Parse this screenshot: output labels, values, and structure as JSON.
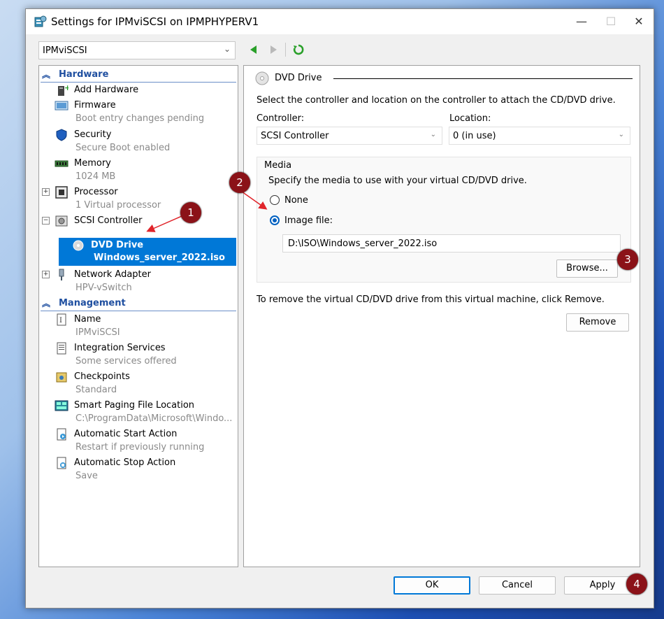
{
  "window": {
    "title": "Settings for IPMviSCSI on IPMPHYPERV1",
    "minimize_glyph": "—",
    "maximize_glyph": "☐",
    "close_glyph": "✕"
  },
  "vm_selector": {
    "value": "IPMviSCSI",
    "arrow": "⌄"
  },
  "tree": {
    "hardware_heading": "Hardware",
    "management_heading": "Management",
    "items": {
      "add_hardware": {
        "label": "Add Hardware",
        "icon": "add-hardware-icon"
      },
      "firmware": {
        "label": "Firmware",
        "sub": "Boot entry changes pending",
        "icon": "firmware-icon"
      },
      "security": {
        "label": "Security",
        "sub": "Secure Boot enabled",
        "icon": "shield-icon"
      },
      "memory": {
        "label": "Memory",
        "sub": "1024 MB",
        "icon": "memory-icon"
      },
      "processor": {
        "label": "Processor",
        "sub": "1 Virtual processor",
        "icon": "processor-icon",
        "expander": "+"
      },
      "scsi": {
        "label": "SCSI Controller",
        "icon": "scsi-controller-icon",
        "expander": "−"
      },
      "dvd": {
        "label": "DVD Drive",
        "sub": "Windows_server_2022.iso",
        "icon": "dvd-icon"
      },
      "network": {
        "label": "Network Adapter",
        "sub": "HPV-vSwitch",
        "icon": "network-adapter-icon",
        "expander": "+"
      },
      "name": {
        "label": "Name",
        "sub": "IPMviSCSI",
        "icon": "name-icon"
      },
      "integration": {
        "label": "Integration Services",
        "sub": "Some services offered",
        "icon": "integration-services-icon"
      },
      "checkpoints": {
        "label": "Checkpoints",
        "sub": "Standard",
        "icon": "checkpoints-icon"
      },
      "paging": {
        "label": "Smart Paging File Location",
        "sub": "C:\\ProgramData\\Microsoft\\Windo...",
        "icon": "paging-file-icon"
      },
      "autostart": {
        "label": "Automatic Start Action",
        "sub": "Restart if previously running",
        "icon": "auto-start-icon"
      },
      "autostop": {
        "label": "Automatic Stop Action",
        "sub": "Save",
        "icon": "auto-stop-icon"
      }
    }
  },
  "content": {
    "group_title": "DVD Drive",
    "instruction": "Select the controller and location on the controller to attach the CD/DVD drive.",
    "controller_label": "Controller:",
    "controller_value": "SCSI Controller",
    "location_label": "Location:",
    "location_value": "0 (in use)",
    "media_title": "Media",
    "media_instruction": "Specify the media to use with your virtual CD/DVD drive.",
    "none_label": "None",
    "image_file_label": "Image file:",
    "image_path": "D:\\ISO\\Windows_server_2022.iso",
    "browse_label": "Browse...",
    "remove_instruction": "To remove the virtual CD/DVD drive from this virtual machine, click Remove.",
    "remove_label": "Remove",
    "selected_media": "Image file"
  },
  "footer": {
    "ok_label": "OK",
    "cancel_label": "Cancel",
    "apply_label": "Apply"
  },
  "annotations": [
    "1",
    "2",
    "3",
    "4"
  ],
  "colors": {
    "selection": "#0078d7",
    "badge": "#8b1218",
    "arrow": "#e0242a",
    "heading": "#1f4fa0"
  }
}
